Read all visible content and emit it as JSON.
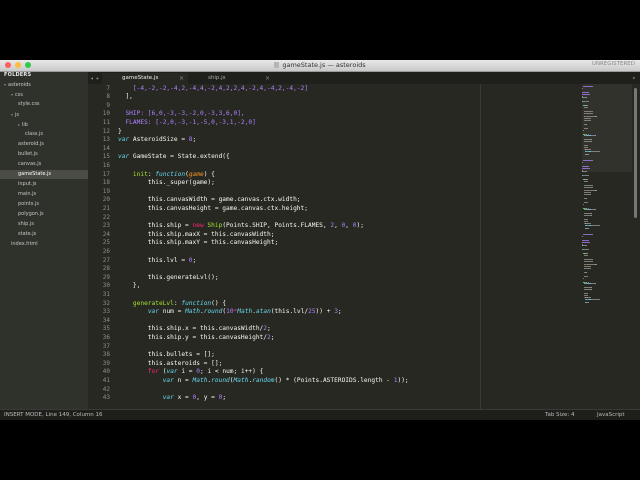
{
  "window": {
    "title": "gameState.js",
    "project": "asteroids",
    "unregistered": "UNREGISTERED"
  },
  "sidebar": {
    "header": "FOLDERS",
    "items": [
      {
        "label": "asteroids",
        "depth": 0,
        "arrow": "▾"
      },
      {
        "label": "css",
        "depth": 1,
        "arrow": "▾"
      },
      {
        "label": "style.css",
        "depth": 2,
        "arrow": ""
      },
      {
        "label": "js",
        "depth": 1,
        "arrow": "▾"
      },
      {
        "label": "lib",
        "depth": 2,
        "arrow": "▸"
      },
      {
        "label": "class.js",
        "depth": 3,
        "arrow": ""
      },
      {
        "label": "asteroid.js",
        "depth": 2,
        "arrow": ""
      },
      {
        "label": "bullet.js",
        "depth": 2,
        "arrow": ""
      },
      {
        "label": "canvas.js",
        "depth": 2,
        "arrow": ""
      },
      {
        "label": "gameState.js",
        "depth": 2,
        "arrow": "",
        "selected": true
      },
      {
        "label": "input.js",
        "depth": 2,
        "arrow": ""
      },
      {
        "label": "main.js",
        "depth": 2,
        "arrow": ""
      },
      {
        "label": "points.js",
        "depth": 2,
        "arrow": ""
      },
      {
        "label": "polygon.js",
        "depth": 2,
        "arrow": ""
      },
      {
        "label": "ship.js",
        "depth": 2,
        "arrow": ""
      },
      {
        "label": "state.js",
        "depth": 2,
        "arrow": ""
      },
      {
        "label": "index.html",
        "depth": 1,
        "arrow": ""
      }
    ]
  },
  "tabs": [
    {
      "label": "gameState.js",
      "active": true,
      "close": "×"
    },
    {
      "label": "ship.js",
      "active": false,
      "close": "×"
    }
  ],
  "tab_nav": {
    "left": "◂",
    "right": "▸",
    "menu": "▾"
  },
  "editor": {
    "line_numbers": [
      "7",
      "8",
      "9",
      "10",
      "11",
      "12",
      "13",
      "14",
      "15",
      "16",
      "17",
      "18",
      "19",
      "20",
      "21",
      "22",
      "23",
      "24",
      "25",
      "26",
      "27",
      "28",
      "29",
      "30",
      "31",
      "32",
      "33",
      "34",
      "35",
      "36",
      "37",
      "38",
      "39",
      "40",
      "41",
      "42",
      "43"
    ],
    "lines": [
      [
        {
          "t": "    [-4,-2,-2,-4,2,-4,4,-2,4,2,2,4,-2,4,-4,2,-4,-2]",
          "c": "n"
        }
      ],
      [
        {
          "t": "  ],",
          "c": "d"
        }
      ],
      [
        {
          "t": "",
          "c": "d"
        }
      ],
      [
        {
          "t": "  SHIP: [6,0,-3,-3,-2,0,-3,3,6,0],",
          "c": "n"
        }
      ],
      [
        {
          "t": "  FLAMES: [-2,0,-3,-1,-5,0,-3,1,-2,0]",
          "c": "n"
        }
      ],
      [
        {
          "t": "}",
          "c": "d"
        }
      ],
      [
        {
          "t": "var ",
          "c": "c"
        },
        {
          "t": "AsteroidSize = ",
          "c": "d"
        },
        {
          "t": "8",
          "c": "n"
        },
        {
          "t": ";",
          "c": "d"
        }
      ],
      [
        {
          "t": "",
          "c": "d"
        }
      ],
      [
        {
          "t": "var ",
          "c": "c"
        },
        {
          "t": "GameState = State.extend({",
          "c": "d"
        }
      ],
      [
        {
          "t": "",
          "c": "d"
        }
      ],
      [
        {
          "t": "    ",
          "c": "d"
        },
        {
          "t": "init",
          "c": "f"
        },
        {
          "t": ": ",
          "c": "d"
        },
        {
          "t": "function",
          "c": "c"
        },
        {
          "t": "(",
          "c": "d"
        },
        {
          "t": "game",
          "c": "i"
        },
        {
          "t": ") {",
          "c": "d"
        }
      ],
      [
        {
          "t": "        this._super(game);",
          "c": "d"
        }
      ],
      [
        {
          "t": "",
          "c": "d"
        }
      ],
      [
        {
          "t": "        this.canvasWidth = game.canvas.ctx.width;",
          "c": "d"
        }
      ],
      [
        {
          "t": "        this.canvasHeight = game.canvas.ctx.height;",
          "c": "d"
        }
      ],
      [
        {
          "t": "",
          "c": "d"
        }
      ],
      [
        {
          "t": "        this.ship = ",
          "c": "d"
        },
        {
          "t": "new ",
          "c": "k"
        },
        {
          "t": "Ship",
          "c": "f"
        },
        {
          "t": "(Points.SHIP, Points.FLAMES, ",
          "c": "d"
        },
        {
          "t": "2",
          "c": "n"
        },
        {
          "t": ", ",
          "c": "d"
        },
        {
          "t": "0",
          "c": "n"
        },
        {
          "t": ", ",
          "c": "d"
        },
        {
          "t": "0",
          "c": "n"
        },
        {
          "t": ");",
          "c": "d"
        }
      ],
      [
        {
          "t": "        this.ship.maxX = this.canvasWidth;",
          "c": "d"
        }
      ],
      [
        {
          "t": "        this.ship.maxY = this.canvasHeight;",
          "c": "d"
        }
      ],
      [
        {
          "t": "",
          "c": "d"
        }
      ],
      [
        {
          "t": "        this.lvl = ",
          "c": "d"
        },
        {
          "t": "0",
          "c": "n"
        },
        {
          "t": ";",
          "c": "d"
        }
      ],
      [
        {
          "t": "",
          "c": "d"
        }
      ],
      [
        {
          "t": "        this.generateLvl();",
          "c": "d"
        }
      ],
      [
        {
          "t": "    },",
          "c": "d"
        }
      ],
      [
        {
          "t": "",
          "c": "d"
        }
      ],
      [
        {
          "t": "    ",
          "c": "d"
        },
        {
          "t": "generateLvl",
          "c": "f"
        },
        {
          "t": ": ",
          "c": "d"
        },
        {
          "t": "function",
          "c": "c"
        },
        {
          "t": "() {",
          "c": "d"
        }
      ],
      [
        {
          "t": "        ",
          "c": "d"
        },
        {
          "t": "var ",
          "c": "c"
        },
        {
          "t": "num = ",
          "c": "d"
        },
        {
          "t": "Math",
          "c": "c"
        },
        {
          "t": ".",
          "c": "d"
        },
        {
          "t": "round",
          "c": "c"
        },
        {
          "t": "(",
          "c": "d"
        },
        {
          "t": "10",
          "c": "n"
        },
        {
          "t": "*",
          "c": "k"
        },
        {
          "t": "Math",
          "c": "c"
        },
        {
          "t": ".",
          "c": "d"
        },
        {
          "t": "atan",
          "c": "c"
        },
        {
          "t": "(this.lvl/",
          "c": "d"
        },
        {
          "t": "25",
          "c": "n"
        },
        {
          "t": ")) + ",
          "c": "d"
        },
        {
          "t": "3",
          "c": "n"
        },
        {
          "t": ";",
          "c": "d"
        }
      ],
      [
        {
          "t": "",
          "c": "d"
        }
      ],
      [
        {
          "t": "        this.ship.x = this.canvasWidth/",
          "c": "d"
        },
        {
          "t": "2",
          "c": "n"
        },
        {
          "t": ";",
          "c": "d"
        }
      ],
      [
        {
          "t": "        this.ship.y = this.canvasHeight/",
          "c": "d"
        },
        {
          "t": "2",
          "c": "n"
        },
        {
          "t": ";",
          "c": "d"
        }
      ],
      [
        {
          "t": "",
          "c": "d"
        }
      ],
      [
        {
          "t": "        this.bullets = [];",
          "c": "d"
        }
      ],
      [
        {
          "t": "        this.asteroids = [];",
          "c": "d"
        }
      ],
      [
        {
          "t": "        ",
          "c": "d"
        },
        {
          "t": "for ",
          "c": "k"
        },
        {
          "t": "(",
          "c": "d"
        },
        {
          "t": "var ",
          "c": "c"
        },
        {
          "t": "i = ",
          "c": "d"
        },
        {
          "t": "0",
          "c": "n"
        },
        {
          "t": "; i < num; i++) {",
          "c": "d"
        }
      ],
      [
        {
          "t": "            ",
          "c": "d"
        },
        {
          "t": "var ",
          "c": "c"
        },
        {
          "t": "n = ",
          "c": "d"
        },
        {
          "t": "Math",
          "c": "c"
        },
        {
          "t": ".",
          "c": "d"
        },
        {
          "t": "round",
          "c": "c"
        },
        {
          "t": "(",
          "c": "d"
        },
        {
          "t": "Math",
          "c": "c"
        },
        {
          "t": ".",
          "c": "d"
        },
        {
          "t": "random",
          "c": "c"
        },
        {
          "t": "() * (Points.ASTEROIDS.length - ",
          "c": "d"
        },
        {
          "t": "1",
          "c": "n"
        },
        {
          "t": "));",
          "c": "d"
        }
      ],
      [
        {
          "t": "",
          "c": "d"
        }
      ],
      [
        {
          "t": "            ",
          "c": "d"
        },
        {
          "t": "var ",
          "c": "c"
        },
        {
          "t": "x = ",
          "c": "d"
        },
        {
          "t": "0",
          "c": "n"
        },
        {
          "t": ", y = ",
          "c": "d"
        },
        {
          "t": "0",
          "c": "n"
        },
        {
          "t": ";",
          "c": "d"
        }
      ]
    ]
  },
  "status": {
    "left": "INSERT MODE, Line 149, Column 16",
    "tab_size": "Tab Size: 4",
    "syntax": "JavaScript"
  },
  "colors": {
    "background": "#272822",
    "keyword": "#f92672",
    "number": "#ae81ff",
    "function": "#a6e22e",
    "storage": "#66d9ef",
    "parameter": "#fd971f",
    "close": "#fc605c",
    "minimize": "#fdbc40",
    "zoom": "#34c84a"
  }
}
